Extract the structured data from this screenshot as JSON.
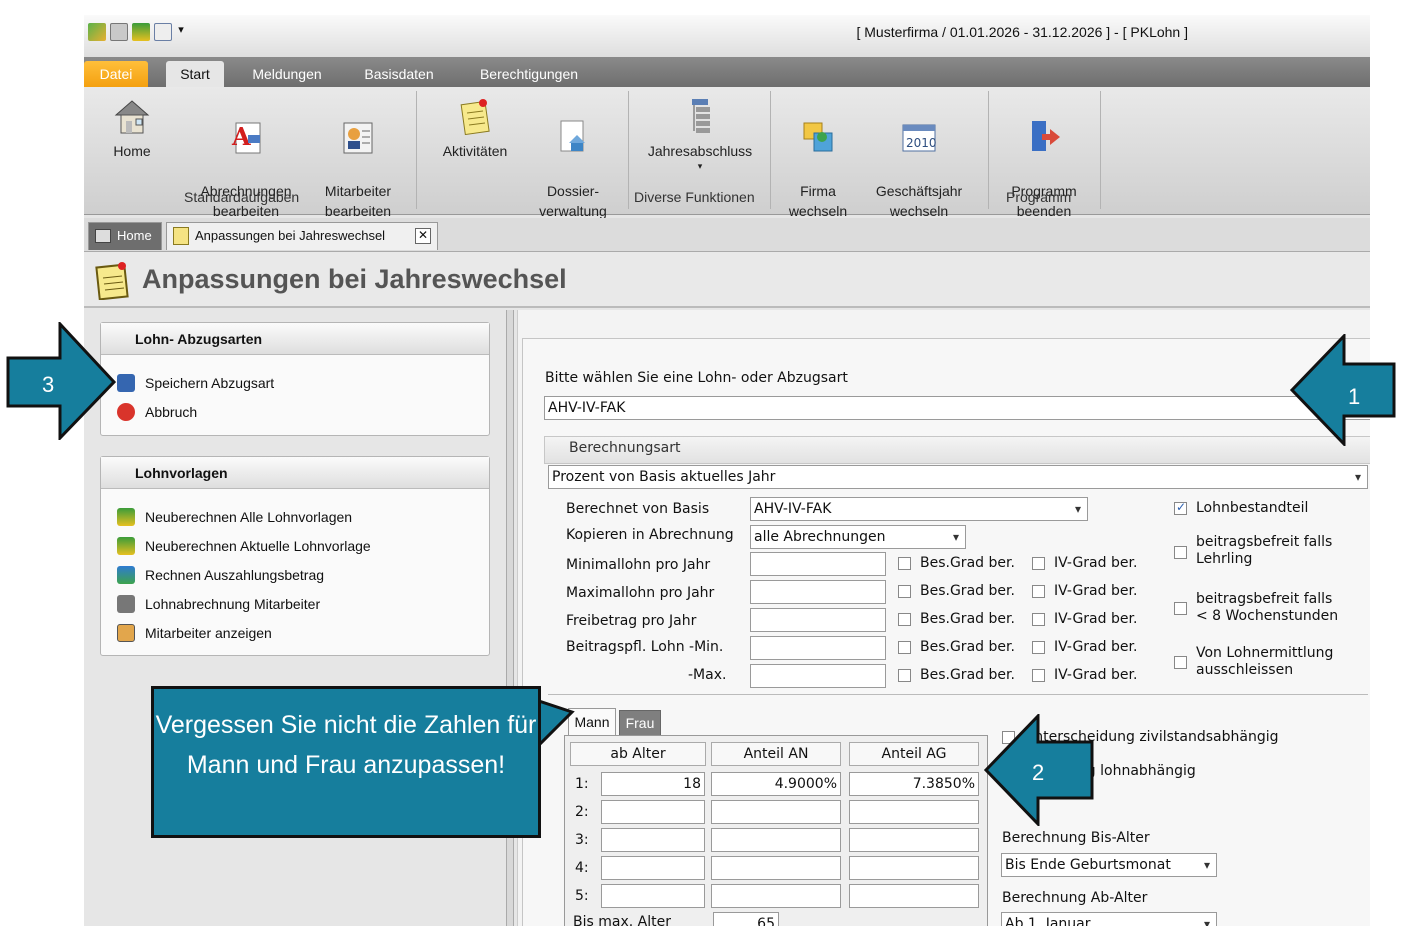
{
  "window": {
    "title": "[ Musterfirma / 01.01.2026 - 31.12.2026 ] - [ PKLohn ]"
  },
  "menu": {
    "tabs": [
      "Datei",
      "Start",
      "Meldungen",
      "Basisdaten",
      "Berechtigungen"
    ]
  },
  "ribbon": {
    "home": "Home",
    "abrechnungen": "Abrechnungen\nbearbeiten",
    "mitarbeiter": "Mitarbeiter\nbearbeiten",
    "aktivitaeten": "Aktivitäten",
    "dossier": "Dossier-\nverwaltung",
    "jahresabschluss": "Jahresabschluss",
    "firma": "Firma\nwechseln",
    "geschaeftsjahr": "Geschäftsjahr\nwechseln",
    "programm": "Programm\nbeenden",
    "group_standard": "Standardaufgaben",
    "group_diverse": "Diverse Funktionen",
    "group_programm": "Programm"
  },
  "doctabs": {
    "home": "Home",
    "anpassungen": "Anpassungen bei Jahreswechsel"
  },
  "page_title": "Anpassungen bei Jahreswechsel",
  "panel1": {
    "title": "Lohn- Abzugsarten",
    "items": [
      "Speichern Abzugsart",
      "Abbruch"
    ]
  },
  "panel2": {
    "title": "Lohnvorlagen",
    "items": [
      "Neuberechnen Alle Lohnvorlagen",
      "Neuberechnen Aktuelle Lohnvorlage",
      "Rechnen Auszahlungsbetrag",
      "Lohnabrechnung Mitarbeiter",
      "Mitarbeiter anzeigen"
    ]
  },
  "form": {
    "select_label": "Bitte wählen Sie eine Lohn- oder Abzugsart",
    "select_value": "AHV-IV-FAK",
    "group_title": "Berechnungsart",
    "berechnungsart": "Prozent von Basis aktuelles Jahr",
    "basis_label": "Berechnet von Basis",
    "basis_value": "AHV-IV-FAK",
    "kopieren_label": "Kopieren in Abrechnung",
    "kopieren_value": "alle Abrechnungen",
    "rows": [
      "Minimallohn pro Jahr",
      "Maximallohn pro Jahr",
      "Freibetrag pro Jahr",
      "Beitragspfl. Lohn -Min.",
      "-Max."
    ],
    "bes_grad": "Bes.Grad ber.",
    "iv_grad": "IV-Grad ber.",
    "lohnbestandteil": "Lohnbestandteil",
    "befreit_lehrling": "beitragsbefreit falls\nLehrling",
    "befreit_wochen": "beitragsbefreit falls\n< 8 Wochenstunden",
    "ausschliessen": "Von Lohnermittlung\nausschleissen",
    "tab_mann": "Mann",
    "tab_frau": "Frau",
    "col_alter": "ab Alter",
    "col_an": "Anteil AN",
    "col_ag": "Anteil AG",
    "row_nums": [
      "1:",
      "2:",
      "3:",
      "4:",
      "5:"
    ],
    "row1": {
      "alter": "18",
      "an": "4.9000%",
      "ag": "7.3850%"
    },
    "bis_max_label": "Bis max. Alter",
    "bis_max_value": "65",
    "zivilstand": "Unterscheidung zivilstandsabhängig",
    "lohnabhaengig": "Abstufung lohnabhängig",
    "bis_alter_label": "Berechnung Bis-Alter",
    "bis_alter_value": "Bis Ende Geburtsmonat",
    "ab_alter_label": "Berechnung Ab-Alter",
    "ab_alter_value": "Ab 1. Januar"
  },
  "annotations": {
    "n1": "1",
    "n2": "2",
    "n3": "3",
    "callout": "Vergessen Sie nicht die Zahlen für Mann und Frau anzupassen!"
  }
}
